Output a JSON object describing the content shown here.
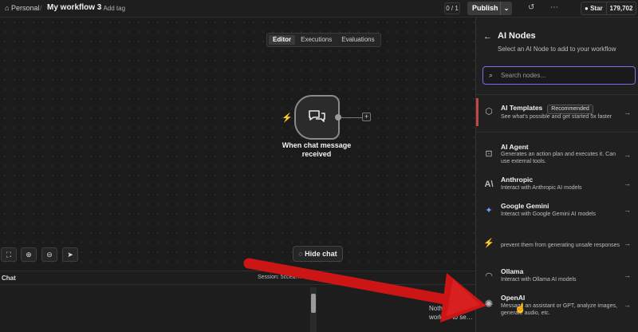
{
  "topbar": {
    "workspace": "Personal",
    "separator": "/",
    "workflow_title": "My workflow 3",
    "add_tag": "+ Add tag",
    "counter": "0 / 1",
    "publish_label": "Publish",
    "github_star": "Star",
    "github_count": "179,702"
  },
  "canvas": {
    "tabs": [
      {
        "label": "Editor",
        "active": true
      },
      {
        "label": "Executions",
        "active": false
      },
      {
        "label": "Evaluations",
        "active": false
      }
    ],
    "node": {
      "label": "When chat message received",
      "icon": "chat-bubbles-icon"
    },
    "hide_chat_label": "Hide chat"
  },
  "chat": {
    "title": "Chat",
    "session": "Session: 5cceа…",
    "empty_line1": "Nothing to d…",
    "empty_line2": "workf… to se…"
  },
  "panel": {
    "title": "AI Nodes",
    "subtitle": "Select an AI Node to add to your workflow",
    "search_placeholder": "Search nodes...",
    "items": [
      {
        "name": "AI Templates",
        "badge": "Recommended",
        "desc": "See what's possible and get started 5x faster",
        "icon": "template-icon"
      },
      {
        "name": "AI Agent",
        "desc": "Generates an action plan and executes it. Can use external tools.",
        "icon": "robot-icon"
      },
      {
        "name": "Anthropic",
        "desc": "Interact with Anthropic AI models",
        "icon": "anthropic-icon"
      },
      {
        "name": "Google Gemini",
        "desc": "Interact with Google Gemini AI models",
        "icon": "gemini-icon"
      },
      {
        "name": "",
        "desc": "prevent them from generating unsafe responses",
        "icon": "guard-icon"
      },
      {
        "name": "Ollama",
        "desc": "Interact with Ollama AI models",
        "icon": "ollama-icon"
      },
      {
        "name": "OpenAI",
        "desc": "Message an assistant or GPT, analyze images, generate audio, etc.",
        "icon": "openai-icon"
      }
    ]
  },
  "colors": {
    "accent": "#7c6cf0",
    "arrow": "#cc1515",
    "trigger": "#e05555"
  }
}
